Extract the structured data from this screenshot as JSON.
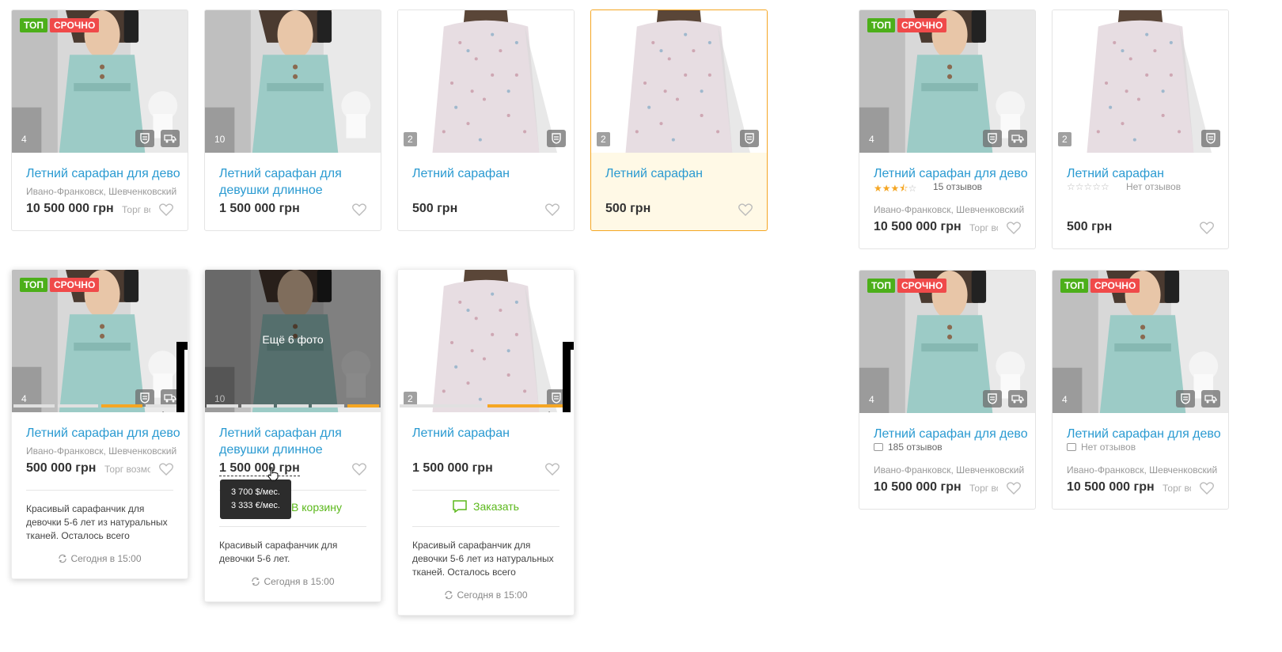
{
  "badges": {
    "top": "ТОП",
    "urgent": "СРОЧНО"
  },
  "title_short": "Летний сарафан для девочки",
  "title_long": "Летний сарафан для девушки длинное название",
  "title_plain": "Летний сарафан",
  "location": "Ивано-Франковск, Шевченковский",
  "bargain": "Торг возможен",
  "counts": {
    "c4": "4",
    "c10": "10",
    "c2": "2"
  },
  "prices": {
    "p10m": "10 500 000 грн",
    "p1_5m": "1 500 000 грн",
    "p500": "500 грн",
    "p500k": "500 000 грн"
  },
  "reviews": {
    "r15": "15 отзывов",
    "none": "Нет отзывов",
    "r185": "185 отзывов",
    "rating15": 3.5
  },
  "more_photos": "Ещё 6  фото",
  "tooltip": {
    "usd": "3 700 $/мес.",
    "eur": "3 333 €/мес."
  },
  "cart_label": "В корзину",
  "order_label": "Заказать",
  "desc_long": "Красивый сарафанчик для девочки 5-6 лет из натуральных тканей. Осталось всего несколько штук",
  "desc_short": "Красивый сарафанчик для девочки 5-6 лет.",
  "date": "Сегодня в 15:00",
  "colors": {
    "link": "#2a9ad1",
    "top": "#4caf1a",
    "urgent": "#f04a4a",
    "accent": "#f5a623",
    "order": "#5bb81b"
  }
}
